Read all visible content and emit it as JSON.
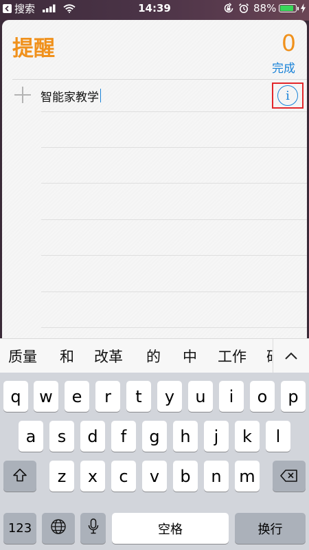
{
  "status_bar": {
    "back_app": "搜索",
    "time": "14:39",
    "battery_percent": "88%",
    "battery_level": 0.88,
    "battery_color": "#38d85a"
  },
  "reminders": {
    "title": "提醒",
    "done_count": "0",
    "done_label": "完成",
    "new_item_text": "智能家教学",
    "accent_color": "#f0911c",
    "link_color": "#1a83d8",
    "icons": [
      "plus-icon",
      "info-icon"
    ]
  },
  "candidates": {
    "items": [
      "质量",
      "和",
      "改革",
      "的",
      "中",
      "工作",
      "研"
    ],
    "expand_icon": "chevron-up-icon"
  },
  "keyboard": {
    "row1": [
      "q",
      "w",
      "e",
      "r",
      "t",
      "y",
      "u",
      "i",
      "o",
      "p"
    ],
    "row2": [
      "a",
      "s",
      "d",
      "f",
      "g",
      "h",
      "j",
      "k",
      "l"
    ],
    "row3": [
      "z",
      "x",
      "c",
      "v",
      "b",
      "n",
      "m"
    ],
    "numbers_key": "123",
    "space_key": "空格",
    "return_key": "换行",
    "icons": [
      "shift-icon",
      "delete-icon",
      "globe-icon",
      "microphone-icon"
    ]
  }
}
